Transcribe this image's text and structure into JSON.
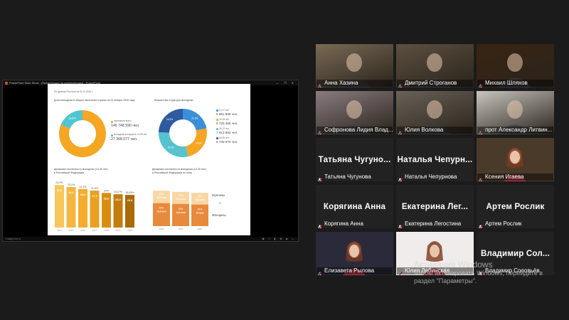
{
  "share": {
    "title": "PowerPoint Slide Show - [Презентация на конференцию] - PowerPoint",
    "window_controls": "— ❐ ✕",
    "status": "Слайд 5 из 11",
    "status_icons": "▣ ▢ ◧ ▤ ◉ ▭"
  },
  "slide": {
    "header_note": "По данным Росстата на 01.01.2020 г.",
    "share_title": "Доля молодежи в общем населении страны на 01 января 2020 года",
    "share_leg1": "население всего",
    "share_val1": "146 748 590 чел.",
    "share_leg2": "молодежь в возрасте 14-35 лет",
    "share_val2": "27 368 077 чел.",
    "share_pct": "18,65%",
    "age_title": "Возрастная структура молодежи",
    "age_labels": [
      "14-17 лет",
      "18-24 лет",
      "25-27 лет",
      "28-35 лет"
    ],
    "age_values": [
      "5 981 609 чел.",
      "6 725 306 чел.",
      "7 913 992 чел.",
      "6 736 970 чел."
    ],
    "age_pcts": [
      "21,9%",
      "24,6%",
      "29,0%",
      "24,6%"
    ],
    "dyn_title": "Динамика численности молодежи (14-30 лет)",
    "dyn_subtitle": "в Российской Федерации",
    "gender_title": "Динамика численности молодежи (14-30 лет)",
    "gender_subtitle": "в Российской Федерации по полу",
    "men_label": "Мужчины",
    "women_label": "Женщины"
  },
  "chart_data": [
    {
      "type": "pie",
      "title": "Доля молодежи в общем населении страны на 01 января 2020 года",
      "categories": [
        "население всего",
        "молодежь в возрасте 14-35 лет"
      ],
      "values": [
        81.35,
        18.65
      ]
    },
    {
      "type": "pie",
      "title": "Возрастная структура молодежи",
      "categories": [
        "14-17 лет",
        "18-24 лет",
        "25-27 лет",
        "28-35 лет"
      ],
      "values": [
        21.9,
        24.6,
        29.0,
        24.6
      ]
    },
    {
      "type": "bar",
      "title": "Динамика численности молодежи (14-30 лет)",
      "categories": [
        "2014",
        "2015",
        "2016",
        "2017",
        "2018",
        "2019",
        "2020"
      ],
      "values": [
        25.9,
        24.7,
        23.5,
        22.5,
        21.1,
        20.3,
        19.9
      ],
      "labels_top": [
        "23,9%",
        "23,1%",
        "22,3%",
        "21,5%",
        "20%",
        "19,27%",
        "18,65%"
      ],
      "labels_in": [
        "31,6",
        "30,1",
        "29,0",
        "27,3",
        "26,6",
        "26,0",
        "25,6"
      ]
    },
    {
      "type": "bar",
      "title": "Динамика численности молодежи (14-30 лет)",
      "categories": [
        "2018",
        "2019",
        "2020"
      ],
      "series": [
        {
          "name": "Мужчины",
          "values": [
            14.1,
            13.7,
            13.3
          ]
        },
        {
          "name": "Женщины",
          "values": [
            14.9,
            14.4,
            14.0
          ]
        }
      ],
      "labels_men": [
        "50%",
        "49%",
        "49%"
      ],
      "labels_women": [
        "50%",
        "51%",
        "51%"
      ]
    }
  ],
  "participants": [
    {
      "name": "Анна Хазина",
      "type": "video",
      "bg": "#7a6a55",
      "active": false
    },
    {
      "name": "Дмитрий Строганов",
      "type": "video",
      "bg": "#5d5040",
      "active": false
    },
    {
      "name": "Михаил Шляхов",
      "type": "video",
      "bg": "#3a2412",
      "active": true
    },
    {
      "name": "Софронова Лидия Влад...",
      "type": "video",
      "bg": "#8a7c80",
      "active": false
    },
    {
      "name": "Юлия Волкова",
      "type": "video",
      "bg": "#6a6258",
      "active": false
    },
    {
      "name": "прот Александр Литвин...",
      "type": "video",
      "bg": "#c8c4bf",
      "active": false
    },
    {
      "name": "Татьяна Чугунова",
      "big": "Татьяна Чугуно...",
      "type": "name",
      "active": false
    },
    {
      "name": "Наталья Чепурнова",
      "big": "Наталья Чепурн...",
      "type": "name",
      "active": false
    },
    {
      "name": "Ксения Игаева",
      "type": "photo",
      "bg": "#4a3a2a",
      "active": false
    },
    {
      "name": "Корягина Анна",
      "big": "Корягина Анна",
      "type": "name",
      "active": false
    },
    {
      "name": "Екатерина Легостина",
      "big": "Екатерина Лег...",
      "type": "name",
      "active": false
    },
    {
      "name": "Артем Рослик",
      "big": "Артем Рослик",
      "type": "name",
      "active": false
    },
    {
      "name": "Елизавета Рылова",
      "type": "photo",
      "bg": "#2a2a3a",
      "active": false
    },
    {
      "name": "Юлия Лябинская",
      "type": "photo",
      "bg": "#f0eceb",
      "active": false
    },
    {
      "name": "Владимир Соловьёв",
      "big": "Владимир Сол...",
      "type": "name",
      "active": false
    }
  ],
  "watermark": {
    "title": "Активация Windows",
    "line1": "Чтобы активировать Windows, перейдите в",
    "line2": "раздел \"Параметры\"."
  },
  "colors": {
    "accent_active": "#c9d62a",
    "mic_muted": "#e02020"
  }
}
